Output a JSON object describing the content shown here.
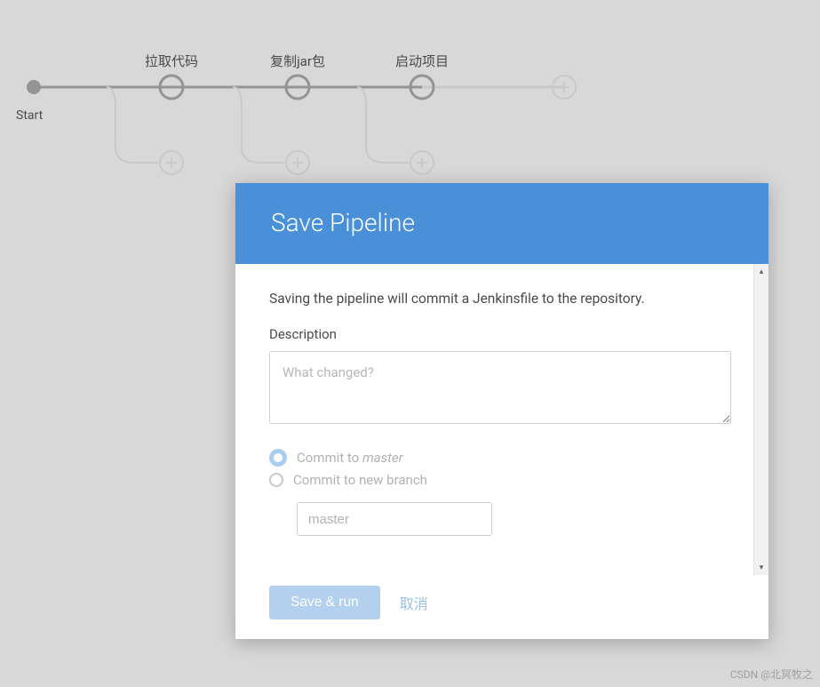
{
  "pipeline": {
    "start_label": "Start",
    "stages": [
      {
        "label": "拉取代码"
      },
      {
        "label": "复制jar包"
      },
      {
        "label": "启动项目"
      }
    ]
  },
  "modal": {
    "title": "Save Pipeline",
    "intro": "Saving the pipeline will commit a Jenkinsfile to the repository.",
    "description_label": "Description",
    "description_placeholder": "What changed?",
    "description_value": "",
    "commit_options": {
      "selected": "master",
      "to_master_label_prefix": "Commit to ",
      "to_master_branch": "master",
      "to_new_branch_label": "Commit to new branch",
      "branch_input_value": "master"
    },
    "save_button": "Save & run",
    "cancel_button": "取消"
  },
  "watermark": "CSDN @北冥牧之"
}
